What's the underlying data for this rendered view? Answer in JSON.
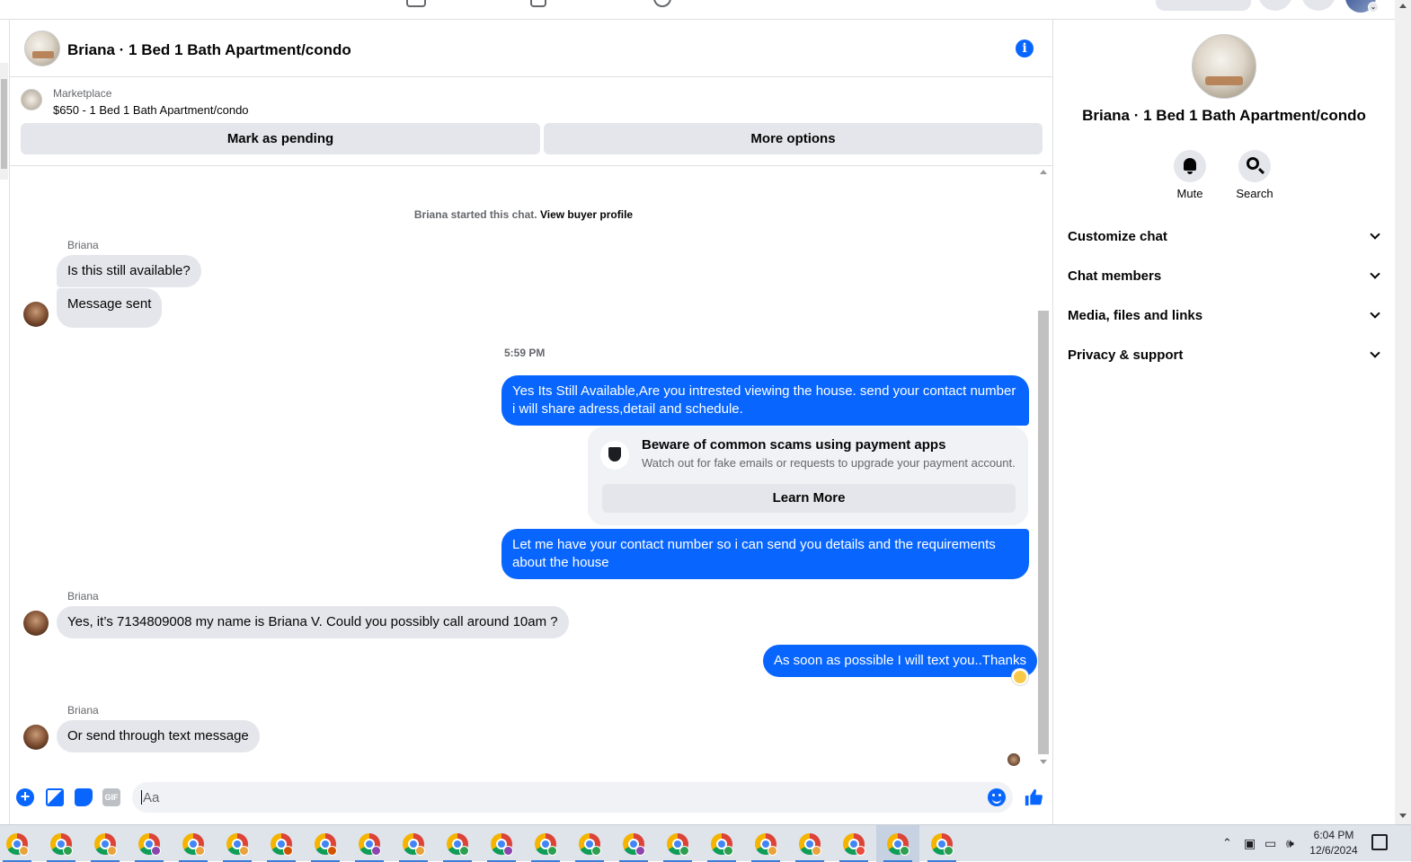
{
  "conversation": {
    "title": "Briana · 1 Bed 1 Bath Apartment/condo",
    "listing_source": "Marketplace",
    "listing_title": "$650 - 1 Bed 1 Bath Apartment/condo",
    "mark_pending_label": "Mark as pending",
    "more_options_label": "More options",
    "system_text": "Briana started this chat.",
    "system_link": "View buyer profile"
  },
  "messages": {
    "m1_sender": "Briana",
    "m1_text": "Is this still available?",
    "m2_text": "Message sent",
    "timestamp": "5:59 PM",
    "m3_text": "Yes Its Still Available,Are you intrested viewing the house. send your contact number i will share adress,detail and schedule.",
    "scam_title": "Beware of common scams using payment apps",
    "scam_desc": "Watch out for fake emails or requests to upgrade your payment account.",
    "scam_button": "Learn More",
    "m4_text": "Let me have your contact number so i can send you details and the requirements about the house",
    "m5_sender": "Briana",
    "m5_text": "Yes, it’s 7134809008 my name is Briana V. Could you possibly call around 10am ?",
    "m6_text": "As soon as possible I will text you..Thanks",
    "m7_sender": "Briana",
    "m7_text": "Or send through text message"
  },
  "composer": {
    "placeholder": "Aa"
  },
  "info_panel": {
    "title": "Briana · 1 Bed 1 Bath Apartment/condo",
    "mute_label": "Mute",
    "search_label": "Search",
    "sections": [
      "Customize chat",
      "Chat members",
      "Media, files and links",
      "Privacy & support"
    ]
  },
  "taskbar": {
    "time": "6:04 PM",
    "date": "12/6/2024",
    "profile_colors": [
      "#e8a33c",
      "#2e9e4f",
      "#e8a33c",
      "#8e44ad",
      "#e8a33c",
      "#e8a33c",
      "#d35400",
      "#d35400",
      "#8e44ad",
      "#e8a33c",
      "#2e9e4f",
      "#8e44ad",
      "#2e9e4f",
      "#2e9e4f",
      "#8e44ad",
      "#2e9e4f",
      "#2e9e4f",
      "#e8a33c",
      "#e8a33c",
      "#e74c3c",
      "#2e9e4f",
      "#2e9e4f"
    ]
  },
  "colors": {
    "messenger_blue": "#0866ff",
    "incoming_bubble": "#e4e6eb"
  }
}
